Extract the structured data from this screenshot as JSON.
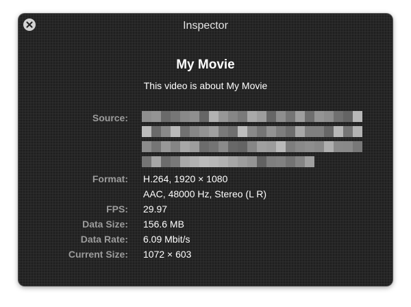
{
  "window": {
    "title": "Inspector"
  },
  "movie": {
    "title": "My Movie",
    "description": "This video is about My Movie"
  },
  "fields": {
    "source_label": "Source:",
    "format_label": "Format:",
    "format_video": "H.264, 1920 × 1080",
    "format_audio": "AAC, 48000 Hz, Stereo (L R)",
    "fps_label": "FPS:",
    "fps_value": "29.97",
    "data_size_label": "Data Size:",
    "data_size_value": "156.6 MB",
    "data_rate_label": "Data Rate:",
    "data_rate_value": "6.09 Mbit/s",
    "current_size_label": "Current Size:",
    "current_size_value": "1072 × 603"
  },
  "icons": {
    "close": "close-icon",
    "source_redacted": "pixelated-redaction"
  },
  "colors": {
    "window_bg": "#262626",
    "label": "#9c9c9c",
    "value": "#ffffff",
    "close_button": "#d4d4d4"
  }
}
